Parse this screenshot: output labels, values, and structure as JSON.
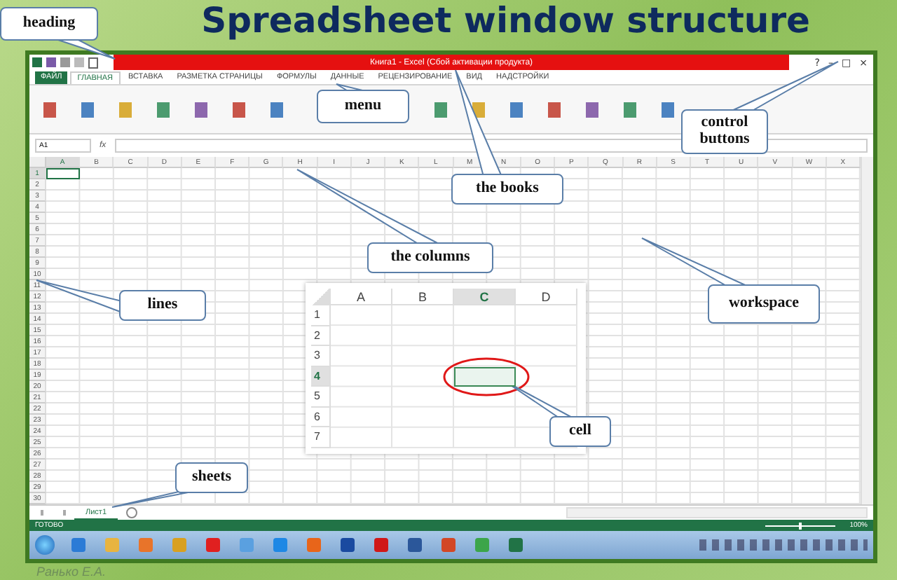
{
  "slide_title": "Spreadsheet window structure",
  "excel": {
    "title": "Книга1 - Excel (Сбой активации продукта)",
    "window_controls": [
      "?",
      "–",
      "□",
      "×"
    ],
    "tabs": [
      {
        "label": "ФАЙЛ",
        "selected": false,
        "kind": "file"
      },
      {
        "label": "ГЛАВНАЯ",
        "selected": true,
        "kind": "tab"
      },
      {
        "label": "ВСТАВКА",
        "selected": false,
        "kind": "tab"
      },
      {
        "label": "РАЗМЕТКА СТРАНИЦЫ",
        "selected": false,
        "kind": "tab"
      },
      {
        "label": "ФОРМУЛЫ",
        "selected": false,
        "kind": "tab"
      },
      {
        "label": "ДАННЫЕ",
        "selected": false,
        "kind": "tab"
      },
      {
        "label": "РЕЦЕНЗИРОВАНИЕ",
        "selected": false,
        "kind": "tab"
      },
      {
        "label": "ВИД",
        "selected": false,
        "kind": "tab"
      },
      {
        "label": "НАДСТРОЙКИ",
        "selected": false,
        "kind": "tab"
      }
    ],
    "name_box": "A1",
    "formula_label": "fx",
    "columns": [
      {
        "label": "A",
        "selected": true
      },
      {
        "label": "B",
        "selected": false
      },
      {
        "label": "C",
        "selected": false
      },
      {
        "label": "D",
        "selected": false
      },
      {
        "label": "E",
        "selected": false
      },
      {
        "label": "F",
        "selected": false
      },
      {
        "label": "G",
        "selected": false
      },
      {
        "label": "H",
        "selected": false
      },
      {
        "label": "I",
        "selected": false
      },
      {
        "label": "J",
        "selected": false
      },
      {
        "label": "K",
        "selected": false
      },
      {
        "label": "L",
        "selected": false
      },
      {
        "label": "M",
        "selected": false
      },
      {
        "label": "N",
        "selected": false
      },
      {
        "label": "O",
        "selected": false
      },
      {
        "label": "P",
        "selected": false
      },
      {
        "label": "Q",
        "selected": false
      },
      {
        "label": "R",
        "selected": false
      },
      {
        "label": "S",
        "selected": false
      },
      {
        "label": "T",
        "selected": false
      },
      {
        "label": "U",
        "selected": false
      },
      {
        "label": "V",
        "selected": false
      },
      {
        "label": "W",
        "selected": false
      },
      {
        "label": "X",
        "selected": false
      }
    ],
    "rows": [
      {
        "label": "1",
        "selected": true
      },
      {
        "label": "2",
        "selected": false
      },
      {
        "label": "3",
        "selected": false
      },
      {
        "label": "4",
        "selected": false
      },
      {
        "label": "5",
        "selected": false
      },
      {
        "label": "6",
        "selected": false
      },
      {
        "label": "7",
        "selected": false
      },
      {
        "label": "8",
        "selected": false
      },
      {
        "label": "9",
        "selected": false
      },
      {
        "label": "10",
        "selected": false
      },
      {
        "label": "11",
        "selected": false
      },
      {
        "label": "12",
        "selected": false
      },
      {
        "label": "13",
        "selected": false
      },
      {
        "label": "14",
        "selected": false
      },
      {
        "label": "15",
        "selected": false
      },
      {
        "label": "16",
        "selected": false
      },
      {
        "label": "17",
        "selected": false
      },
      {
        "label": "18",
        "selected": false
      },
      {
        "label": "19",
        "selected": false
      },
      {
        "label": "20",
        "selected": false
      },
      {
        "label": "21",
        "selected": false
      },
      {
        "label": "22",
        "selected": false
      },
      {
        "label": "23",
        "selected": false
      },
      {
        "label": "24",
        "selected": false
      },
      {
        "label": "25",
        "selected": false
      },
      {
        "label": "26",
        "selected": false
      },
      {
        "label": "27",
        "selected": false
      },
      {
        "label": "28",
        "selected": false
      },
      {
        "label": "29",
        "selected": false
      },
      {
        "label": "30",
        "selected": false
      }
    ],
    "sheets": [
      {
        "label": "Лист1",
        "selected": true
      }
    ],
    "status": "ГОТОВО",
    "zoom_slider": {
      "level": 0.5
    },
    "zoom": "100%"
  },
  "inset": {
    "columns": [
      {
        "label": "A",
        "selected": false
      },
      {
        "label": "B",
        "selected": false
      },
      {
        "label": "C",
        "selected": true
      },
      {
        "label": "D",
        "selected": false
      }
    ],
    "rows": [
      {
        "label": "1",
        "selected": false
      },
      {
        "label": "2",
        "selected": false
      },
      {
        "label": "3",
        "selected": false
      },
      {
        "label": "4",
        "selected": true
      },
      {
        "label": "5",
        "selected": false
      },
      {
        "label": "6",
        "selected": false
      },
      {
        "label": "7",
        "selected": false
      }
    ]
  },
  "callouts": [
    "heading",
    "menu",
    "the books",
    "control buttons",
    "the columns",
    "workspace",
    "lines",
    "cell",
    "sheets"
  ],
  "author": "Ранько Е.А."
}
